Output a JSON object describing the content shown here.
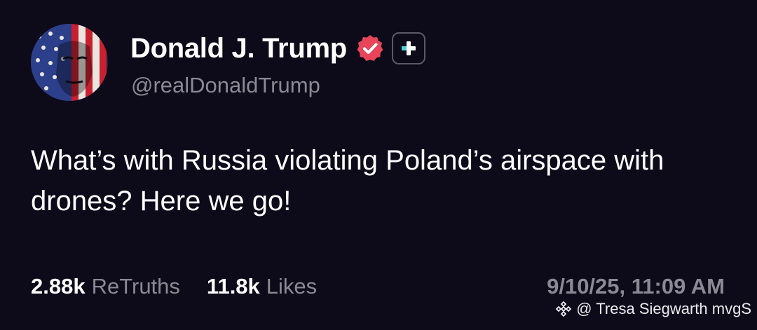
{
  "post": {
    "author": {
      "display_name": "Donald J. Trump",
      "handle": "@realDonaldTrump",
      "verified": true,
      "badge_color": "#e8455a"
    },
    "text": "What’s with Russia violating Poland’s airspace with drones? Here we go!",
    "stats": {
      "retruths_count": "2.88k",
      "retruths_label": "ReTruths",
      "likes_count": "11.8k",
      "likes_label": "Likes"
    },
    "timestamp": "9/10/25, 11:09 AM"
  },
  "watermark": {
    "text": "@ Tresa Siegwarth mvgS"
  },
  "theme": {
    "background": "#0d0a1a",
    "text_primary": "#ffffff",
    "text_secondary": "#8a8994",
    "accent_plus": "#4fd1d9"
  }
}
